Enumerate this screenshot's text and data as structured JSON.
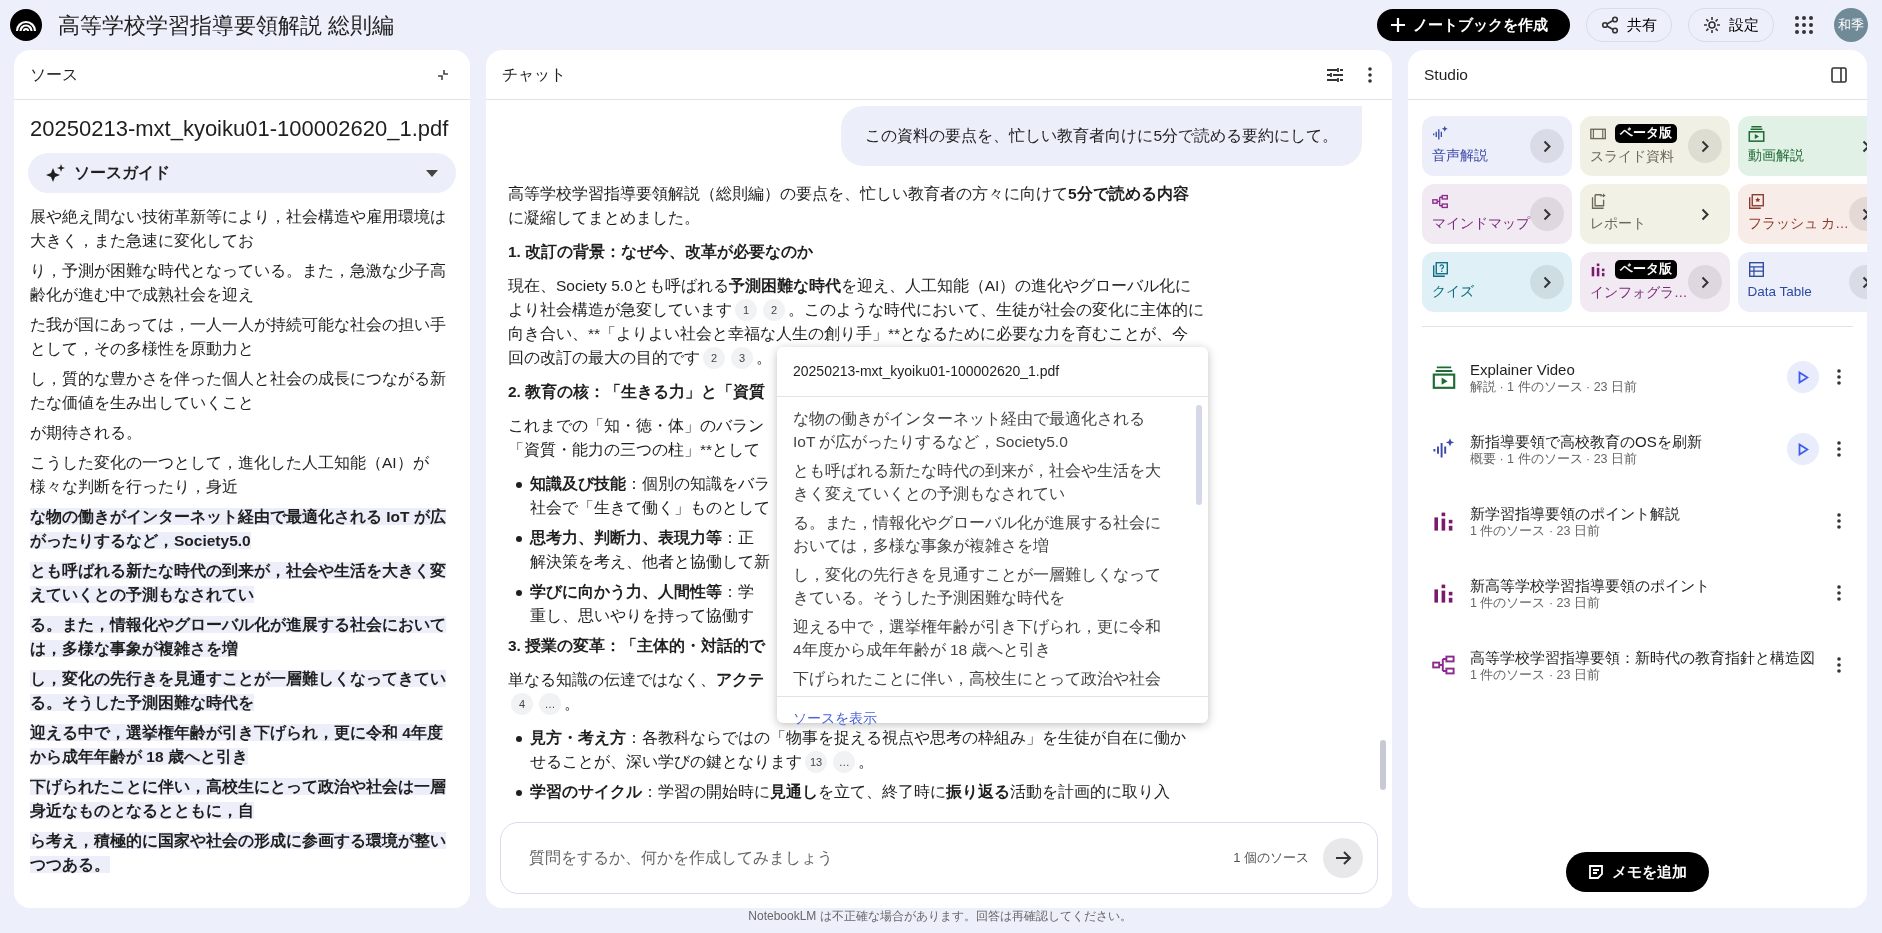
{
  "header": {
    "title": "高等学校学習指導要領解説 総則編",
    "create_button": "ノートブックを作成",
    "share_button": "共有",
    "settings_button": "設定",
    "avatar": "和季"
  },
  "sources": {
    "title": "ソース",
    "file_name": "20250213-mxt_kyoiku01-100002620_1.pdf",
    "guide": "ソースガイド",
    "paragraphs": [
      {
        "highlighted": false,
        "lines": [
          "展や絶え間ない技術革新等により，社会構造や雇用環境は",
          "大きく，また急速に変化してお"
        ]
      },
      {
        "highlighted": false,
        "lines": [
          "り，予測が困難な時代となっている。また，急激な少子高",
          "齢化が進む中で成熟社会を迎え"
        ]
      },
      {
        "highlighted": false,
        "lines": [
          "た我が国にあっては，一人一人が持続可能な社会の担い手",
          "として，その多様性を原動力と"
        ]
      },
      {
        "highlighted": false,
        "lines": [
          "し，質的な豊かさを伴った個人と社会の成長につながる新",
          "たな価値を生み出していくこと"
        ]
      },
      {
        "highlighted": false,
        "lines": [
          "が期待される。"
        ]
      },
      {
        "highlighted": false,
        "lines": [
          "こうした変化の一つとして，進化した人工知能（AI）が",
          "様々な判断を行ったり，身近"
        ]
      },
      {
        "highlighted": true,
        "lines": [
          "な物の働きがインターネット経由で最適化される IoT が広",
          "がったりするなど，Society5.0"
        ]
      },
      {
        "highlighted": true,
        "lines": [
          "とも呼ばれる新たな時代の到来が，社会や生活を大きく変",
          "えていくとの予測もなされてい"
        ]
      },
      {
        "highlighted": true,
        "lines": [
          "る。また，情報化やグローバル化が進展する社会において",
          "は，多様な事象が複雑さを増"
        ]
      },
      {
        "highlighted": true,
        "lines": [
          "し，変化の先行きを見通すことが一層難しくなってきてい",
          "る。そうした予測困難な時代を"
        ]
      },
      {
        "highlighted": true,
        "lines": [
          "迎える中で，選挙権年齢が引き下げられ，更に令和 4年度",
          "から成年年齢が 18 歳へと引き"
        ]
      },
      {
        "highlighted": true,
        "lines": [
          "下げられたことに伴い，高校生にとって政治や社会は一層",
          "身近なものとなるとともに，自"
        ]
      },
      {
        "highlighted": true,
        "lines": [
          "ら考え，積極的に国家や社会の形成に参画する環境が整い",
          "つつある。"
        ]
      }
    ]
  },
  "chat": {
    "title": "チャット",
    "user_message": "この資料の要点を、忙しい教育者向けに5分で読める要約にして。",
    "blocks": [
      {
        "kind": "paragraph",
        "lines": [
          [
            {
              "kind": "text",
              "text": "高等学校学習指導要領解説（総則編）の要点を、忙しい教育者の方々に向けて",
              "bold": false
            },
            {
              "kind": "text",
              "text": "5分で読める内容",
              "bold": true
            }
          ],
          [
            {
              "kind": "text",
              "text": "に凝縮してまとめました。",
              "bold": false
            }
          ]
        ]
      },
      {
        "kind": "heading",
        "text": "1. 改訂の背景：なぜ今、改革が必要なのか"
      },
      {
        "kind": "paragraph",
        "lines": [
          [
            {
              "kind": "text",
              "text": "現在、Society 5.0とも呼ばれる",
              "bold": false
            },
            {
              "kind": "text",
              "text": "予測困難な時代",
              "bold": true
            },
            {
              "kind": "text",
              "text": "を迎え、人工知能（AI）の進化やグローバル化に",
              "bold": false
            }
          ],
          [
            {
              "kind": "text",
              "text": "より社会構造が急変しています",
              "bold": false
            },
            {
              "kind": "cite",
              "text": "1"
            },
            {
              "kind": "cite",
              "text": "2"
            },
            {
              "kind": "text",
              "text": "。このような時代において、生徒が社会の変化に主体的に",
              "bold": false
            }
          ],
          [
            {
              "kind": "text",
              "text": "向き合い、**「よりよい社会と幸福な人生の創り手」**となるために必要な力を育むことが、今",
              "bold": false
            }
          ],
          [
            {
              "kind": "text",
              "text": "回の改訂の最大の目的です",
              "bold": false
            },
            {
              "kind": "cite",
              "text": "2"
            },
            {
              "kind": "cite",
              "text": "3"
            },
            {
              "kind": "text",
              "text": "。",
              "bold": false
            }
          ]
        ]
      },
      {
        "kind": "heading",
        "text": "2. 教育の核：「生きる力」と「資質"
      },
      {
        "kind": "paragraph",
        "lines": [
          [
            {
              "kind": "text",
              "text": "これまでの「知・徳・体」のバラン",
              "bold": false
            }
          ],
          [
            {
              "kind": "text",
              "text": "「資質・能力の三つの柱」**として",
              "bold": false
            }
          ]
        ]
      },
      {
        "kind": "bullet",
        "lines": [
          [
            {
              "kind": "text",
              "text": "知識及び技能",
              "bold": true
            },
            {
              "kind": "text",
              "text": "：個別の知識をバラ",
              "bold": false
            }
          ],
          [
            {
              "kind": "text",
              "text": "社会で「生きて働く」ものとして",
              "bold": false
            }
          ]
        ]
      },
      {
        "kind": "bullet",
        "lines": [
          [
            {
              "kind": "text",
              "text": "思考力、判断力、表現力等",
              "bold": true
            },
            {
              "kind": "text",
              "text": "：正",
              "bold": false
            }
          ],
          [
            {
              "kind": "text",
              "text": "解決策を考え、他者と協働して新",
              "bold": false
            }
          ]
        ]
      },
      {
        "kind": "bullet",
        "lines": [
          [
            {
              "kind": "text",
              "text": "学びに向かう力、人間性等",
              "bold": true
            },
            {
              "kind": "text",
              "text": "：学",
              "bold": false
            }
          ],
          [
            {
              "kind": "text",
              "text": "重し、思いやりを持って協働す",
              "bold": false
            }
          ]
        ]
      },
      {
        "kind": "heading",
        "text": "3. 授業の変革：「主体的・対話的で"
      },
      {
        "kind": "paragraph",
        "lines": [
          [
            {
              "kind": "text",
              "text": "単なる知識の伝達ではなく、",
              "bold": false
            },
            {
              "kind": "text",
              "text": "アクテ",
              "bold": true
            }
          ],
          [
            {
              "kind": "cite",
              "text": "4"
            },
            {
              "kind": "cite",
              "text": "…"
            },
            {
              "kind": "text",
              "text": "。",
              "bold": false
            }
          ]
        ]
      },
      {
        "kind": "bullet",
        "lines": [
          [
            {
              "kind": "text",
              "text": "見方・考え方",
              "bold": true
            },
            {
              "kind": "text",
              "text": "：各教科ならではの「物事を捉える視点や思考の枠組み」を生徒が自在に働か",
              "bold": false
            }
          ],
          [
            {
              "kind": "text",
              "text": "せることが、深い学びの鍵となります",
              "bold": false
            },
            {
              "kind": "cite",
              "text": "13"
            },
            {
              "kind": "cite",
              "text": "…"
            },
            {
              "kind": "text",
              "text": "。",
              "bold": false
            }
          ]
        ]
      },
      {
        "kind": "bullet",
        "lines": [
          [
            {
              "kind": "text",
              "text": "学習のサイクル",
              "bold": true
            },
            {
              "kind": "text",
              "text": "：学習の開始時に",
              "bold": false
            },
            {
              "kind": "text",
              "text": "見通し",
              "bold": true
            },
            {
              "kind": "text",
              "text": "を立て、終了時に",
              "bold": false
            },
            {
              "kind": "text",
              "text": "振り返る",
              "bold": true
            },
            {
              "kind": "text",
              "text": "活動を計画的に取り入",
              "bold": false
            }
          ]
        ]
      }
    ],
    "popover": {
      "title": "20250213-mxt_kyoiku01-100002620_1.pdf",
      "paragraphs": [
        [
          "な物の働きがインターネット経由で最適化される",
          "IoT が広がったりするなど，Society5.0"
        ],
        [
          "とも呼ばれる新たな時代の到来が，社会や生活を大",
          "きく変えていくとの予測もなされてい"
        ],
        [
          "る。また，情報化やグローバル化が進展する社会に",
          "おいては，多様な事象が複雑さを増"
        ],
        [
          "し，変化の先行きを見通すことが一層難しくなって",
          "きている。そうした予測困難な時代を"
        ],
        [
          "迎える中で，選挙権年齢が引き下げられ，更に令和",
          "4年度から成年年齢が 18 歳へと引き"
        ],
        [
          "下げられたことに伴い，高校生にとって政治や社会"
        ]
      ],
      "link": "ソースを表示"
    },
    "input": {
      "placeholder": "質問をするか、何かを作成してみましょう",
      "source_count": "1 個のソース"
    },
    "disclaimer": "NotebookLM は不正確な場合があります。回答は再確認してください。"
  },
  "studio": {
    "title": "Studio",
    "tiles": [
      {
        "kind": "audio",
        "label": "音声解説",
        "color": "#eceffa",
        "beta": false,
        "shaded_chevron": true
      },
      {
        "kind": "slides",
        "label": "スライド資料",
        "color": "#f1f0e4",
        "beta": true,
        "badge": "ベータ版",
        "shaded_chevron": true
      },
      {
        "kind": "video",
        "label": "動画解説",
        "color": "#e2f1e5",
        "beta": false,
        "shaded_chevron": false
      },
      {
        "kind": "mindmap",
        "label": "マインドマップ",
        "color": "#f2eaf2",
        "beta": false,
        "shaded_chevron": true
      },
      {
        "kind": "report",
        "label": "レポート",
        "color": "#f1f1e5",
        "beta": false,
        "shaded_chevron": false
      },
      {
        "kind": "flashcard",
        "label": "フラッシュ カ…",
        "color": "#f8ece9",
        "beta": false,
        "shaded_chevron": true
      },
      {
        "kind": "quiz",
        "label": "クイズ",
        "color": "#dff0f6",
        "beta": false,
        "shaded_chevron": true
      },
      {
        "kind": "infographic",
        "label": "インフォグラ…",
        "color": "#f2eaf2",
        "beta": true,
        "badge": "ベータ版",
        "shaded_chevron": true
      },
      {
        "kind": "table",
        "label": "Data Table",
        "color": "#eceffa",
        "beta": false,
        "shaded_chevron": true
      }
    ],
    "items": [
      {
        "kind": "video",
        "title": "Explainer Video",
        "meta": "解説 · 1 件のソース · 23 日前",
        "playable": true
      },
      {
        "kind": "audio",
        "title": "新指導要領で高校教育のOSを刷新",
        "meta": "概要 · 1 件のソース · 23 日前",
        "playable": true
      },
      {
        "kind": "infographic",
        "title": "新学習指導要領のポイント解説",
        "meta": "1 件のソース · 23 日前",
        "playable": false
      },
      {
        "kind": "infographic",
        "title": "新高等学校学習指導要領のポイント",
        "meta": "1 件のソース · 23 日前",
        "playable": false
      },
      {
        "kind": "mindmap",
        "title": "高等学校学習指導要領：新時代の教育指針と構造図",
        "meta": "1 件のソース · 23 日前",
        "playable": false
      }
    ],
    "note_button": "メモを追加"
  }
}
